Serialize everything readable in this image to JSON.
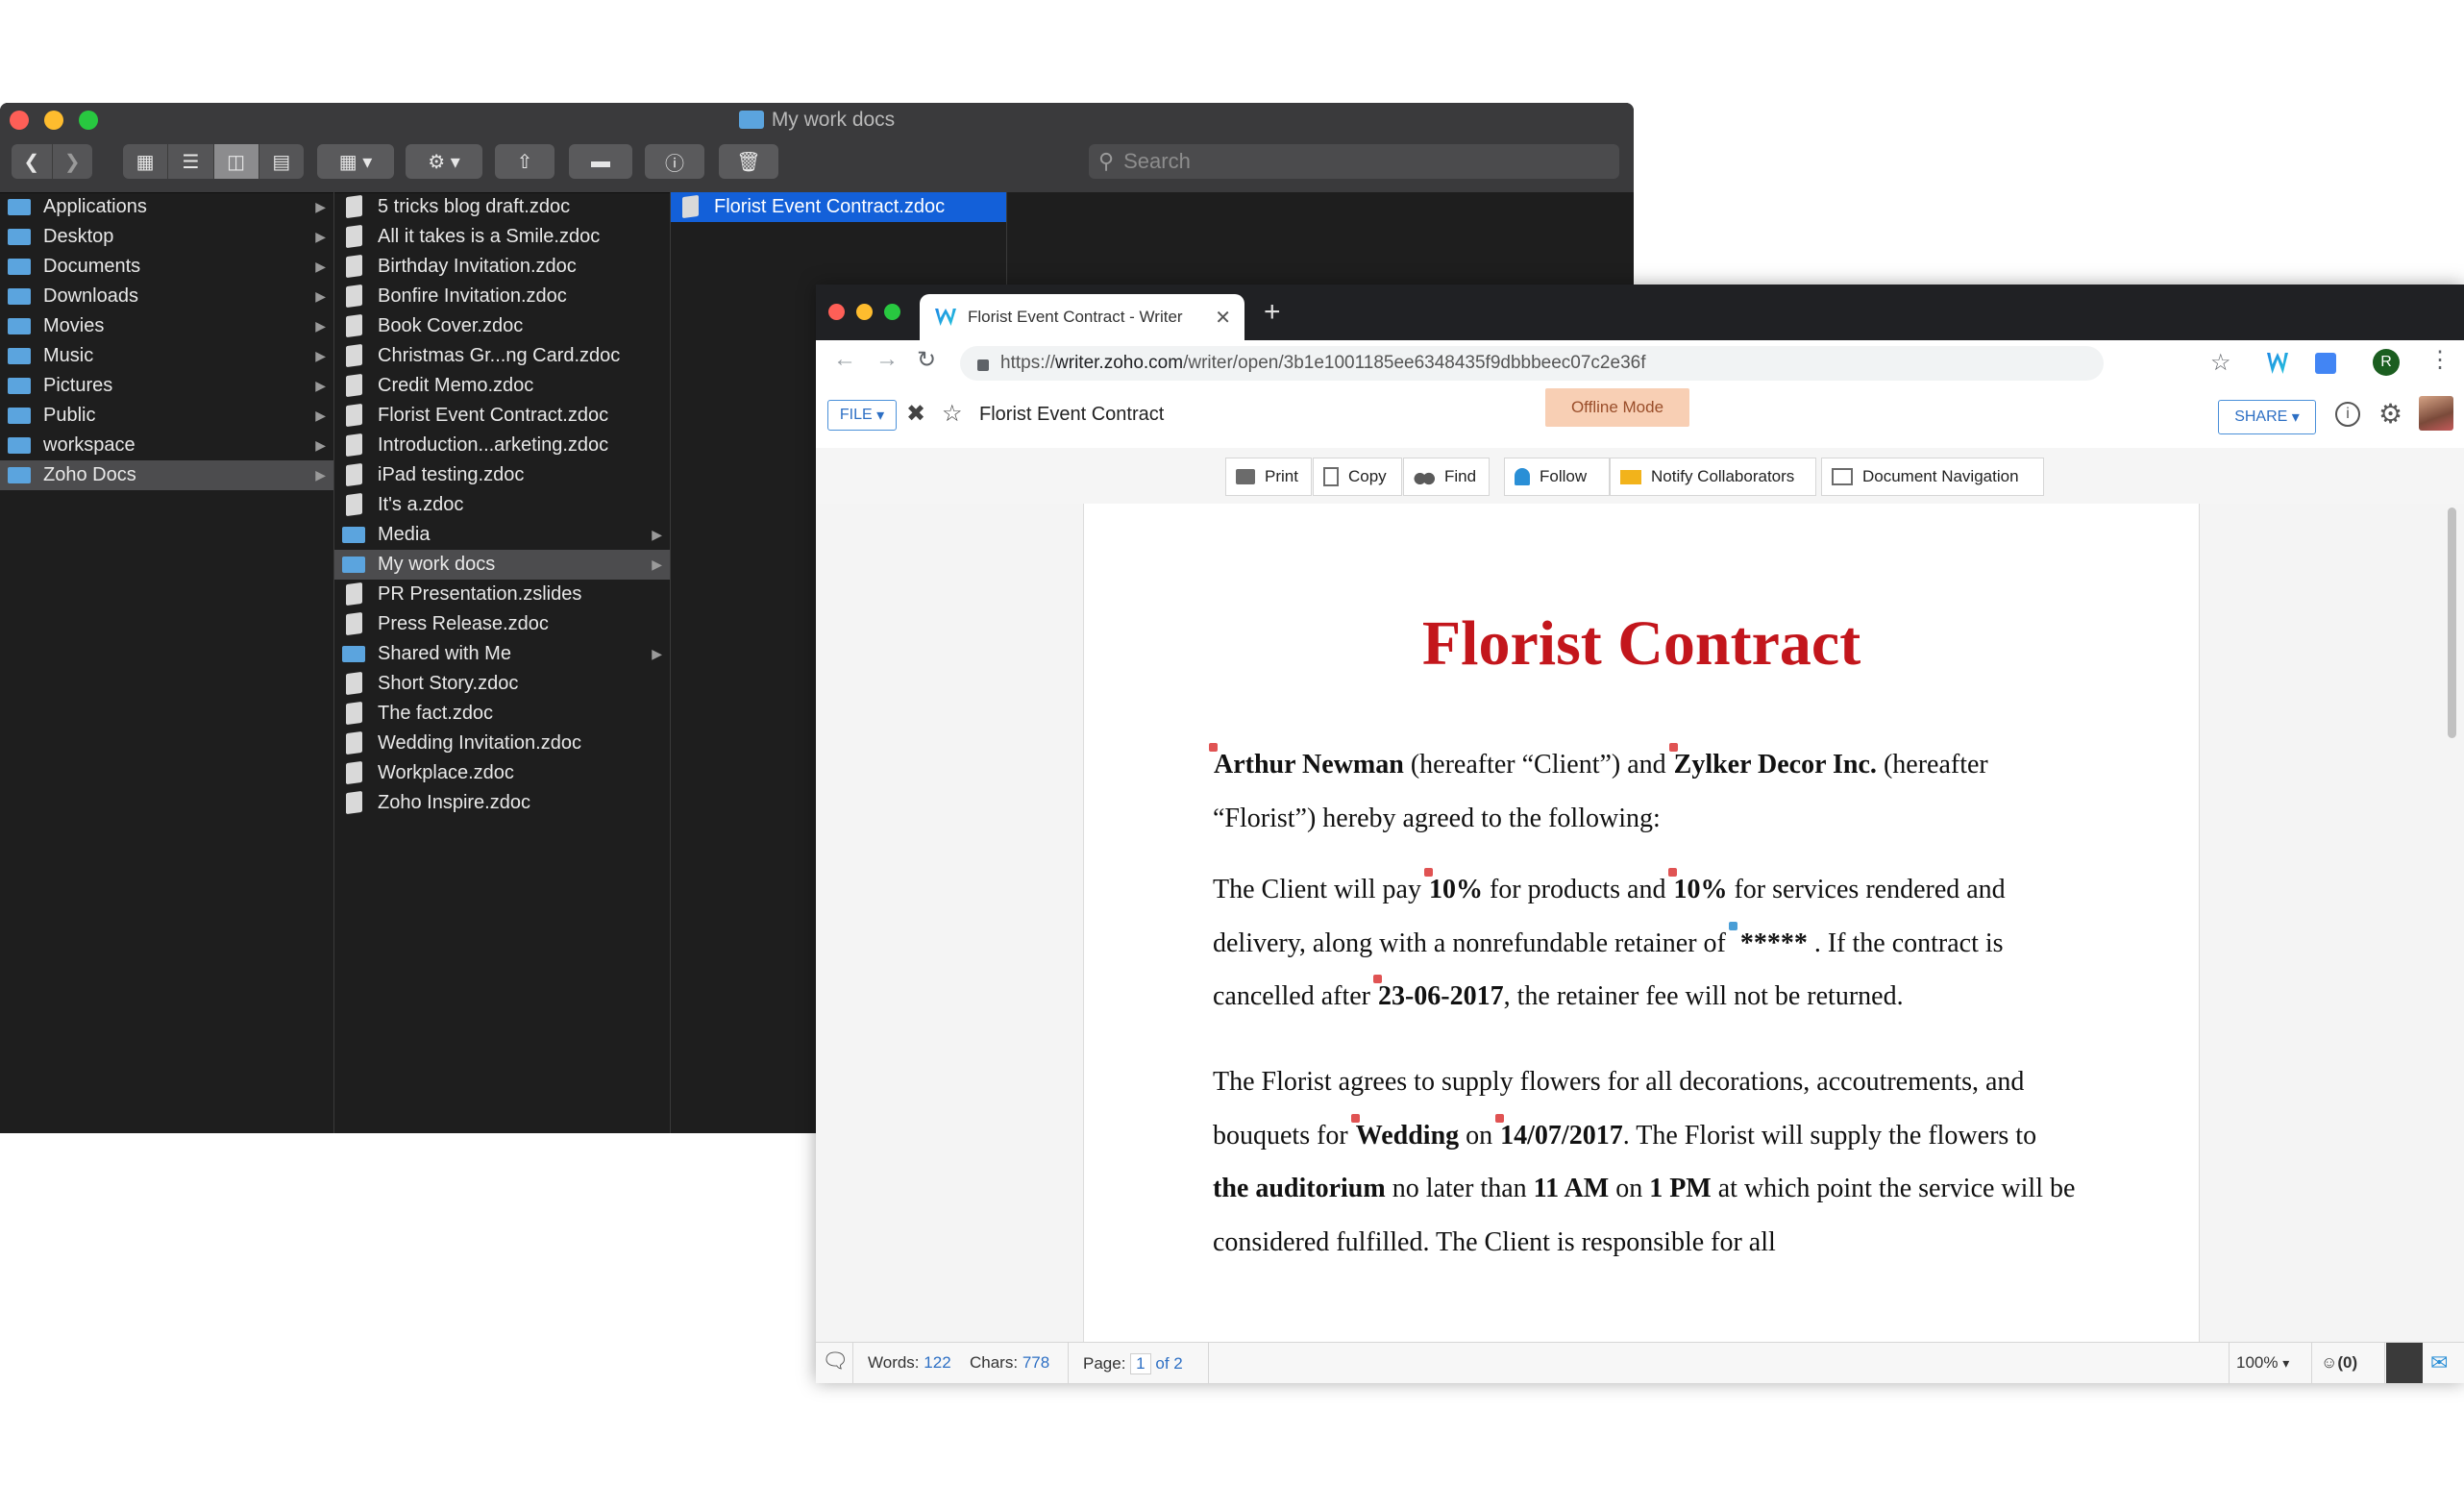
{
  "finder": {
    "title": "My work docs",
    "search_placeholder": "Search",
    "toolbar_icons": [
      "chevron-left-icon",
      "chevron-right-icon",
      "icon-view-icon",
      "list-view-icon",
      "column-view-icon",
      "gallery-view-icon",
      "group-icon",
      "gear-icon",
      "share-icon",
      "tag-icon",
      "info-icon",
      "trash-icon"
    ],
    "sidebar": [
      {
        "label": "Applications"
      },
      {
        "label": "Desktop"
      },
      {
        "label": "Documents"
      },
      {
        "label": "Downloads"
      },
      {
        "label": "Movies"
      },
      {
        "label": "Music"
      },
      {
        "label": "Pictures"
      },
      {
        "label": "Public"
      },
      {
        "label": "workspace"
      },
      {
        "label": "Zoho Docs",
        "selected": true
      }
    ],
    "zoho_docs_items": [
      {
        "label": "5 tricks blog draft.zdoc",
        "type": "doc"
      },
      {
        "label": "All it takes is a Smile.zdoc",
        "type": "doc"
      },
      {
        "label": "Birthday Invitation.zdoc",
        "type": "doc"
      },
      {
        "label": "Bonfire Invitation.zdoc",
        "type": "doc"
      },
      {
        "label": "Book Cover.zdoc",
        "type": "doc"
      },
      {
        "label": "Christmas Gr...ng Card.zdoc",
        "type": "doc"
      },
      {
        "label": "Credit Memo.zdoc",
        "type": "doc"
      },
      {
        "label": "Florist Event Contract.zdoc",
        "type": "doc"
      },
      {
        "label": "Introduction...arketing.zdoc",
        "type": "doc"
      },
      {
        "label": "iPad testing.zdoc",
        "type": "doc"
      },
      {
        "label": "It's a.zdoc",
        "type": "doc"
      },
      {
        "label": "Media",
        "type": "folder"
      },
      {
        "label": "My work docs",
        "type": "folder",
        "selected": true
      },
      {
        "label": "PR Presentation.zslides",
        "type": "doc"
      },
      {
        "label": "Press Release.zdoc",
        "type": "doc"
      },
      {
        "label": "Shared with Me",
        "type": "folder"
      },
      {
        "label": "Short Story.zdoc",
        "type": "doc"
      },
      {
        "label": "The fact.zdoc",
        "type": "doc"
      },
      {
        "label": "Wedding Invitation.zdoc",
        "type": "doc"
      },
      {
        "label": "Workplace.zdoc",
        "type": "doc"
      },
      {
        "label": "Zoho Inspire.zdoc",
        "type": "doc"
      }
    ],
    "my_work_docs_items": [
      {
        "label": "Florist Event Contract.zdoc",
        "selected": true
      }
    ]
  },
  "chrome": {
    "tab_title": "Florist Event Contract - Writer",
    "new_tab": "+",
    "url_prefix": "https://",
    "url_domain": "writer.zoho.com",
    "url_path": "/writer/open/3b1e1001185ee6348435f9dbbbeec07c2e36f",
    "profile_initial": "R"
  },
  "writer": {
    "file_label": "FILE",
    "doc_title": "Florist Event Contract",
    "offline_label": "Offline Mode",
    "share_label": "SHARE",
    "tools": [
      {
        "label": "Print",
        "icon": "printer-icon"
      },
      {
        "label": "Copy",
        "icon": "copy-icon"
      },
      {
        "label": "Find",
        "icon": "binoculars-icon"
      },
      {
        "label": "Follow",
        "icon": "bell-icon"
      },
      {
        "label": "Notify Collaborators",
        "icon": "envelope-icon"
      },
      {
        "label": "Document Navigation",
        "icon": "navigation-icon"
      }
    ],
    "document": {
      "heading": "Florist Contract",
      "p1": {
        "client_name": "Arthur Newman",
        "client_suffix": " (hereafter “Client”)  and ",
        "florist_name": "Zylker Decor Inc.",
        "florist_suffix": " (hereafter “Florist”) hereby agreed to the following:"
      },
      "p2": {
        "a": "The Client will pay ",
        "pct1": "10%",
        "b": " for products and ",
        "pct2": "10%",
        "c": " for services rendered and delivery, along with a nonrefundable retainer of ",
        "retainer": "*****",
        "d": " . If the contract is cancelled after ",
        "date": "23-06-2017",
        "e": ", the retainer fee will not be returned."
      },
      "p3": {
        "a": "The Florist agrees to supply flowers for all decorations, accoutrements, and bouquets for ",
        "event": "Wedding",
        "b": " on ",
        "event_date": "14/07/2017",
        "c": ". The Florist will supply the flowers to ",
        "venue": "the auditorium",
        "d": " no later than ",
        "time1": "11 AM",
        "e": " on ",
        "time2": "1 PM",
        "f": " at which point the service will be considered  fulfilled. The Client is responsible for all"
      }
    },
    "status": {
      "words_label": "Words:",
      "words": "122",
      "chars_label": "Chars:",
      "chars": "778",
      "page_label": "Page:",
      "page_current": "1",
      "page_total": "of 2",
      "zoom": "100%",
      "collaborators": "(0)"
    }
  }
}
